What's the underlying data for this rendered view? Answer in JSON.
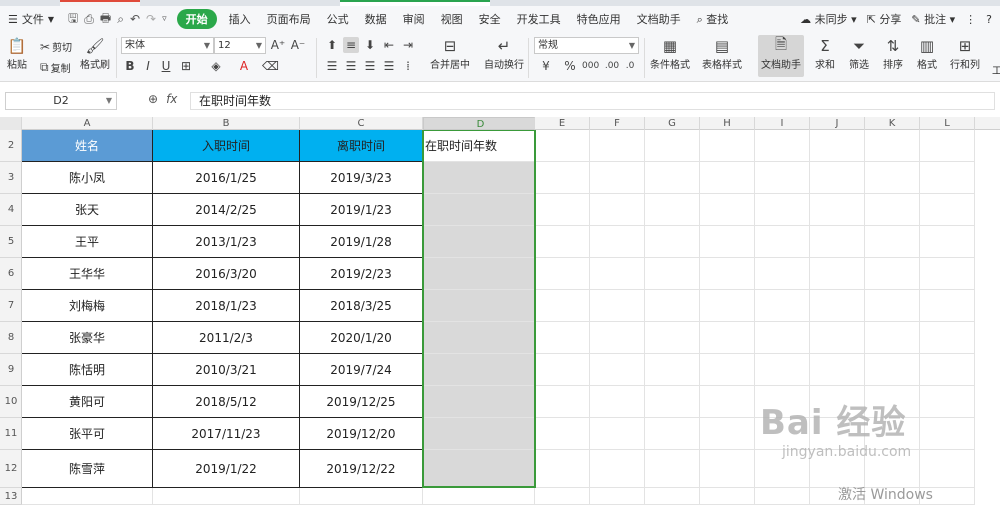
{
  "menu": {
    "file": "文件",
    "tabs": [
      "开始",
      "插入",
      "页面布局",
      "公式",
      "数据",
      "审阅",
      "视图",
      "安全",
      "开发工具",
      "特色应用",
      "文档助手"
    ],
    "active_tab": "开始",
    "search": "查找",
    "sync": "未同步",
    "share": "分享",
    "comment": "批注"
  },
  "ribbon": {
    "paste": "粘贴",
    "cut": "剪切",
    "copy": "复制",
    "format_painter": "格式刷",
    "font_name": "宋体",
    "font_size": "12",
    "merge_center": "合并居中",
    "wrap_text": "自动换行",
    "number_format": "常规",
    "cond_format": "条件格式",
    "table_style": "表格样式",
    "doc_assistant": "文档助手",
    "sum": "求和",
    "filter": "筛选",
    "sort": "排序",
    "format": "格式",
    "row_col": "行和列",
    "tools": "工"
  },
  "formula_bar": {
    "name_box": "D2",
    "fx": "fx",
    "content": "在职时间年数"
  },
  "columns": [
    "A",
    "B",
    "C",
    "D",
    "E",
    "F",
    "G",
    "H",
    "I",
    "J",
    "K",
    "L"
  ],
  "rows": [
    "2",
    "3",
    "4",
    "5",
    "6",
    "7",
    "8",
    "9",
    "10",
    "11",
    "12",
    "13"
  ],
  "table": {
    "headers": [
      "姓名",
      "入职时间",
      "离职时间",
      "在职时间年数"
    ],
    "rows": [
      [
        "陈小凤",
        "2016/1/25",
        "2019/3/23"
      ],
      [
        "张天",
        "2014/2/25",
        "2019/1/23"
      ],
      [
        "王平",
        "2013/1/23",
        "2019/1/28"
      ],
      [
        "王华华",
        "2016/3/20",
        "2019/2/23"
      ],
      [
        "刘梅梅",
        "2018/1/23",
        "2018/3/25"
      ],
      [
        "张豪华",
        "2011/2/3",
        "2020/1/20"
      ],
      [
        "陈恬明",
        "2010/3/21",
        "2019/7/24"
      ],
      [
        "黄阳可",
        "2018/5/12",
        "2019/12/25"
      ],
      [
        "张平可",
        "2017/11/23",
        "2019/12/20"
      ],
      [
        "陈雪萍",
        "2019/1/22",
        "2019/12/22"
      ]
    ]
  },
  "watermark": {
    "logo": "Bai 经验",
    "url": "jingyan.baidu.com"
  },
  "activate": "激活 Windows",
  "colors": {
    "accent": "#2ba84a",
    "header_a": "#5b9bd5",
    "header_bc": "#00b0f0",
    "selection": "#3a9a3a"
  }
}
